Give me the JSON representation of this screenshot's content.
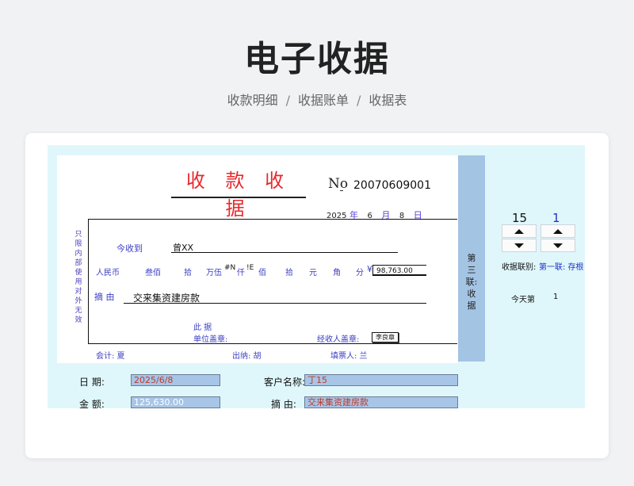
{
  "page": {
    "title": "电子收据",
    "breadcrumb": [
      "收款明细",
      "收据账单",
      "收据表"
    ],
    "breadcrumb_sep": "/"
  },
  "receipt": {
    "title": "收 款 收 据",
    "no_label": "No",
    "no_value": "20070609001",
    "date": {
      "year": "2025",
      "year_label": "年",
      "month": "6",
      "month_label": "月",
      "day": "8",
      "day_label": "日"
    },
    "left_note": [
      "只",
      "限",
      "内",
      "部",
      "使",
      "用",
      "对",
      "外",
      "无",
      "效"
    ],
    "received_label": "今收到",
    "received_value": "曾XX",
    "rmb_label": "人民币",
    "units": [
      "叁佰",
      "拾",
      "万伍",
      "#N",
      "仟",
      "!E",
      "佰",
      "拾",
      "元",
      "角",
      "分"
    ],
    "yen": "¥",
    "amount": "98,763.00",
    "summary_label": "摘  由",
    "summary_value": "交来集资建房款",
    "seal_line1": "此    据",
    "seal_line2": "单位盖章:",
    "handler_label": "经收人盖章:",
    "handler_stamp": "李良章",
    "accountant": "会计: 夏",
    "cashier": "出纳: 胡",
    "drawer": "填票人: 兰",
    "stub_text": [
      "第",
      "三",
      "联:",
      "收",
      "据"
    ]
  },
  "counters": {
    "left_value": "15",
    "right_value": "1",
    "copy_label": "收据联别:",
    "copy_value": "第一联: 存根",
    "today_label": "今天第",
    "today_value": "1"
  },
  "form": {
    "date_label": "日    期:",
    "date_value": "2025/6/8",
    "customer_label": "客户名称:",
    "customer_value": "丁15",
    "amount_label": "金    额:",
    "amount_value": "125,630.00",
    "summary_label": "摘    由:",
    "summary_value": "交来集资建房款"
  },
  "colors": {
    "accent_red": "#e8282d",
    "label_blue": "#3b3fc4",
    "sheet_bg": "#dff7fb",
    "stub_bg": "#a4c4e4",
    "field_bg": "#a7c5e6"
  }
}
